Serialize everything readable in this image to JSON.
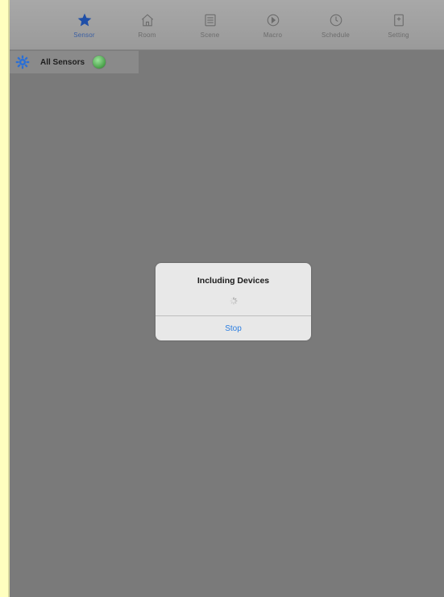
{
  "tabbar": {
    "tabs": [
      {
        "label": "Sensor",
        "icon": "star-icon",
        "active": true
      },
      {
        "label": "Room",
        "icon": "home-icon",
        "active": false
      },
      {
        "label": "Scene",
        "icon": "scene-icon",
        "active": false
      },
      {
        "label": "Macro",
        "icon": "macro-icon",
        "active": false
      },
      {
        "label": "Schedule",
        "icon": "clock-icon",
        "active": false
      },
      {
        "label": "Setting",
        "icon": "setting-icon",
        "active": false
      }
    ]
  },
  "filter": {
    "label": "All Sensors",
    "status_color": "#48a048"
  },
  "dialog": {
    "title": "Including Devices",
    "button_label": "Stop"
  },
  "colors": {
    "accent": "#2a7de1",
    "active_tab": "#1f4fa8",
    "background": "#7a7a7a"
  }
}
